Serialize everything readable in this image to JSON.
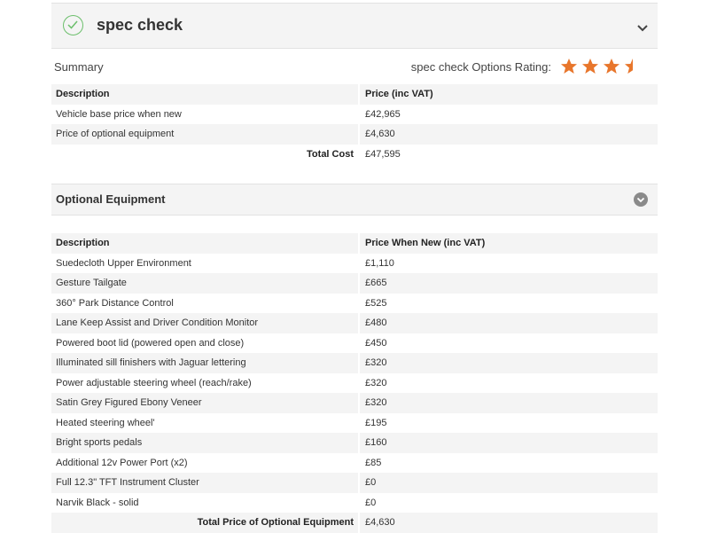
{
  "spec_check": {
    "title": "spec check",
    "icon": "check-circle-icon",
    "collapse_icon": "chevron-down-icon",
    "accent_color": "#6cbf6c"
  },
  "summary": {
    "label": "Summary",
    "rating_label": "spec check Options Rating:",
    "rating_value": 3.5,
    "rating_max": 4,
    "star_color": "#e8762c",
    "headers": [
      "Description",
      "Price (inc VAT)"
    ],
    "rows": [
      {
        "description": "Vehicle base price when new",
        "price": "£42,965"
      },
      {
        "description": "Price of optional equipment",
        "price": "£4,630"
      }
    ],
    "total_label": "Total Cost",
    "total_value": "£47,595"
  },
  "optional_equipment": {
    "title": "Optional Equipment",
    "expand_icon": "chevron-down-circle-icon",
    "headers": [
      "Description",
      "Price When New (inc VAT)"
    ],
    "rows": [
      {
        "description": "Suedecloth Upper Environment",
        "price": "£1,110"
      },
      {
        "description": "Gesture Tailgate",
        "price": "£665"
      },
      {
        "description": "360° Park Distance Control",
        "price": "£525"
      },
      {
        "description": "Lane Keep Assist and Driver Condition Monitor",
        "price": "£480"
      },
      {
        "description": "Powered boot lid (powered open and close)",
        "price": "£450"
      },
      {
        "description": "Illuminated sill finishers with Jaguar lettering",
        "price": "£320"
      },
      {
        "description": "Power adjustable steering wheel (reach/rake)",
        "price": "£320"
      },
      {
        "description": "Satin Grey Figured Ebony Veneer",
        "price": "£320"
      },
      {
        "description": "Heated steering wheel'",
        "price": "£195"
      },
      {
        "description": "Bright sports pedals",
        "price": "£160"
      },
      {
        "description": "Additional 12v Power Port (x2)",
        "price": "£85"
      },
      {
        "description": "Full 12.3\" TFT Instrument Cluster",
        "price": "£0"
      },
      {
        "description": "Narvik Black - solid",
        "price": "£0"
      }
    ],
    "total_label": "Total Price of Optional Equipment",
    "total_value": "£4,630"
  }
}
